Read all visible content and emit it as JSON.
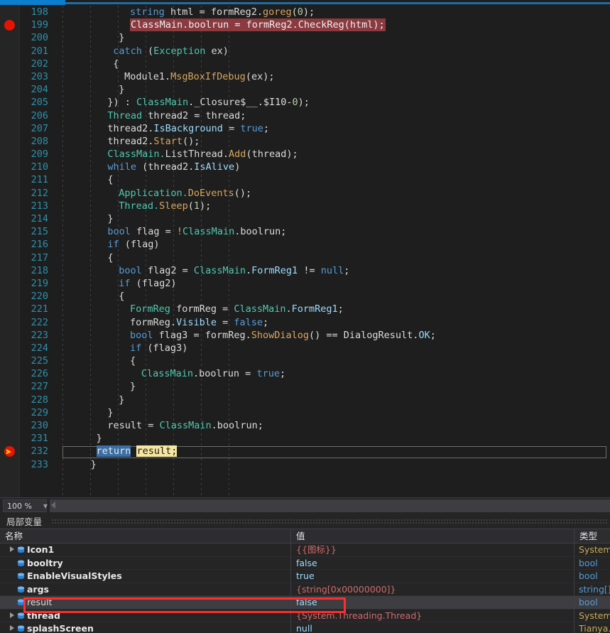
{
  "editor": {
    "zoom_level": "100 %",
    "lines": [
      {
        "num": "198",
        "indent": 12,
        "tokens": [
          {
            "t": "string",
            "c": "k"
          },
          {
            "t": " html = formReg2.",
            "c": "d"
          },
          {
            "t": "goreg",
            "c": "m"
          },
          {
            "t": "(",
            "c": "d"
          },
          {
            "t": "0",
            "c": "n"
          },
          {
            "t": ");",
            "c": "d"
          }
        ]
      },
      {
        "num": "199",
        "indent": 12,
        "breakpoint": true,
        "error_highlight": true,
        "tokens": [
          {
            "t": "ClassMain.boolrun = formReg2.CheckReg(html);",
            "c": "d"
          }
        ]
      },
      {
        "num": "200",
        "indent": 10,
        "tokens": [
          {
            "t": "}",
            "c": "d"
          }
        ]
      },
      {
        "num": "201",
        "indent": 9,
        "tokens": [
          {
            "t": "catch",
            "c": "k"
          },
          {
            "t": " (",
            "c": "d"
          },
          {
            "t": "Exception",
            "c": "t"
          },
          {
            "t": " ex)",
            "c": "d"
          }
        ]
      },
      {
        "num": "202",
        "indent": 9,
        "tokens": [
          {
            "t": "{",
            "c": "d"
          }
        ]
      },
      {
        "num": "203",
        "indent": 11,
        "tokens": [
          {
            "t": "Module1.",
            "c": "d"
          },
          {
            "t": "MsgBoxIfDebug",
            "c": "m"
          },
          {
            "t": "(ex);",
            "c": "d"
          }
        ]
      },
      {
        "num": "204",
        "indent": 10,
        "tokens": [
          {
            "t": "}",
            "c": "d"
          }
        ]
      },
      {
        "num": "205",
        "indent": 8,
        "tokens": [
          {
            "t": "}) : ",
            "c": "d"
          },
          {
            "t": "ClassMain",
            "c": "t"
          },
          {
            "t": "._Closure$__.$I10-",
            "c": "d"
          },
          {
            "t": "0",
            "c": "n"
          },
          {
            "t": ");",
            "c": "d"
          }
        ]
      },
      {
        "num": "206",
        "indent": 8,
        "tokens": [
          {
            "t": "Thread",
            "c": "t"
          },
          {
            "t": " thread2 = thread;",
            "c": "d"
          }
        ]
      },
      {
        "num": "207",
        "indent": 8,
        "tokens": [
          {
            "t": "thread2.",
            "c": "d"
          },
          {
            "t": "IsBackground",
            "c": "p"
          },
          {
            "t": " = ",
            "c": "d"
          },
          {
            "t": "true",
            "c": "k"
          },
          {
            "t": ";",
            "c": "d"
          }
        ]
      },
      {
        "num": "208",
        "indent": 8,
        "tokens": [
          {
            "t": "thread2.",
            "c": "d"
          },
          {
            "t": "Start",
            "c": "m"
          },
          {
            "t": "();",
            "c": "d"
          }
        ]
      },
      {
        "num": "209",
        "indent": 8,
        "tokens": [
          {
            "t": "ClassMain.",
            "c": "t"
          },
          {
            "t": "ListThread.",
            "c": "d"
          },
          {
            "t": "Add",
            "c": "m"
          },
          {
            "t": "(thread);",
            "c": "d"
          }
        ]
      },
      {
        "num": "210",
        "indent": 8,
        "tokens": [
          {
            "t": "while",
            "c": "k"
          },
          {
            "t": " (thread2.",
            "c": "d"
          },
          {
            "t": "IsAlive",
            "c": "p"
          },
          {
            "t": ")",
            "c": "d"
          }
        ]
      },
      {
        "num": "211",
        "indent": 8,
        "tokens": [
          {
            "t": "{",
            "c": "d"
          }
        ]
      },
      {
        "num": "212",
        "indent": 10,
        "tokens": [
          {
            "t": "Application.",
            "c": "t"
          },
          {
            "t": "DoEvents",
            "c": "m"
          },
          {
            "t": "();",
            "c": "d"
          }
        ]
      },
      {
        "num": "213",
        "indent": 10,
        "tokens": [
          {
            "t": "Thread.",
            "c": "t"
          },
          {
            "t": "Sleep",
            "c": "m"
          },
          {
            "t": "(",
            "c": "d"
          },
          {
            "t": "1",
            "c": "n"
          },
          {
            "t": ");",
            "c": "d"
          }
        ]
      },
      {
        "num": "214",
        "indent": 8,
        "tokens": [
          {
            "t": "}",
            "c": "d"
          }
        ]
      },
      {
        "num": "215",
        "indent": 8,
        "tokens": [
          {
            "t": "bool",
            "c": "k"
          },
          {
            "t": " flag = ",
            "c": "d"
          },
          {
            "t": "!",
            "c": "m"
          },
          {
            "t": "ClassMain",
            "c": "t"
          },
          {
            "t": ".boolrun;",
            "c": "d"
          }
        ]
      },
      {
        "num": "216",
        "indent": 8,
        "tokens": [
          {
            "t": "if",
            "c": "k"
          },
          {
            "t": " (flag)",
            "c": "d"
          }
        ]
      },
      {
        "num": "217",
        "indent": 8,
        "tokens": [
          {
            "t": "{",
            "c": "d"
          }
        ]
      },
      {
        "num": "218",
        "indent": 10,
        "tokens": [
          {
            "t": "bool",
            "c": "k"
          },
          {
            "t": " flag2 = ",
            "c": "d"
          },
          {
            "t": "ClassMain",
            "c": "t"
          },
          {
            "t": ".",
            "c": "d"
          },
          {
            "t": "FormReg1",
            "c": "p"
          },
          {
            "t": " != ",
            "c": "d"
          },
          {
            "t": "null",
            "c": "k"
          },
          {
            "t": ";",
            "c": "d"
          }
        ]
      },
      {
        "num": "219",
        "indent": 10,
        "tokens": [
          {
            "t": "if",
            "c": "k"
          },
          {
            "t": " (flag2)",
            "c": "d"
          }
        ]
      },
      {
        "num": "220",
        "indent": 10,
        "tokens": [
          {
            "t": "{",
            "c": "d"
          }
        ]
      },
      {
        "num": "221",
        "indent": 12,
        "tokens": [
          {
            "t": "FormReg",
            "c": "t"
          },
          {
            "t": " formReg = ",
            "c": "d"
          },
          {
            "t": "ClassMain",
            "c": "t"
          },
          {
            "t": ".",
            "c": "d"
          },
          {
            "t": "FormReg1",
            "c": "p"
          },
          {
            "t": ";",
            "c": "d"
          }
        ]
      },
      {
        "num": "222",
        "indent": 12,
        "tokens": [
          {
            "t": "formReg.",
            "c": "d"
          },
          {
            "t": "Visible",
            "c": "p"
          },
          {
            "t": " = ",
            "c": "d"
          },
          {
            "t": "false",
            "c": "k"
          },
          {
            "t": ";",
            "c": "d"
          }
        ]
      },
      {
        "num": "223",
        "indent": 12,
        "tokens": [
          {
            "t": "bool",
            "c": "k"
          },
          {
            "t": " flag3 = formReg.",
            "c": "d"
          },
          {
            "t": "ShowDialog",
            "c": "m"
          },
          {
            "t": "() == DialogResult.",
            "c": "d"
          },
          {
            "t": "OK",
            "c": "p"
          },
          {
            "t": ";",
            "c": "d"
          }
        ]
      },
      {
        "num": "224",
        "indent": 12,
        "tokens": [
          {
            "t": "if",
            "c": "k"
          },
          {
            "t": " (flag3)",
            "c": "d"
          }
        ]
      },
      {
        "num": "225",
        "indent": 12,
        "tokens": [
          {
            "t": "{",
            "c": "d"
          }
        ]
      },
      {
        "num": "226",
        "indent": 14,
        "tokens": [
          {
            "t": "ClassMain",
            "c": "t"
          },
          {
            "t": ".boolrun = ",
            "c": "d"
          },
          {
            "t": "true",
            "c": "k"
          },
          {
            "t": ";",
            "c": "d"
          }
        ]
      },
      {
        "num": "227",
        "indent": 12,
        "tokens": [
          {
            "t": "}",
            "c": "d"
          }
        ]
      },
      {
        "num": "228",
        "indent": 10,
        "tokens": [
          {
            "t": "}",
            "c": "d"
          }
        ]
      },
      {
        "num": "229",
        "indent": 8,
        "tokens": [
          {
            "t": "}",
            "c": "d"
          }
        ]
      },
      {
        "num": "230",
        "indent": 8,
        "tokens": [
          {
            "t": "result = ",
            "c": "d"
          },
          {
            "t": "ClassMain",
            "c": "t"
          },
          {
            "t": ".boolrun;",
            "c": "d"
          }
        ]
      },
      {
        "num": "231",
        "indent": 6,
        "tokens": [
          {
            "t": "}",
            "c": "d"
          }
        ]
      },
      {
        "num": "232",
        "indent": 6,
        "current": true,
        "breakpoint_current": true,
        "tokens": []
      },
      {
        "num": "233",
        "indent": 5,
        "tokens": [
          {
            "t": "}",
            "c": "d"
          }
        ]
      }
    ],
    "current_line": {
      "keyword": "return",
      "expression": "result;"
    }
  },
  "locals": {
    "title": "局部变量",
    "columns": [
      "名称",
      "值",
      "类型"
    ],
    "rows": [
      {
        "expandable": true,
        "name": "Icon1",
        "value": "{{图标}}",
        "value_class": "v-brace",
        "type": "System.D",
        "type_class": "t-class"
      },
      {
        "expandable": false,
        "name": "booltry",
        "value": "false",
        "value_class": "v-bool",
        "type": "bool",
        "type_class": "t-prim"
      },
      {
        "expandable": false,
        "name": "EnableVisualStyles",
        "value": "true",
        "value_class": "v-bool",
        "type": "bool",
        "type_class": "t-prim"
      },
      {
        "expandable": false,
        "name": "args",
        "value": "{string[0x00000000]}",
        "value_class": "v-brace",
        "type": "string[]",
        "type_class": "t-prim"
      },
      {
        "expandable": false,
        "name": "result",
        "value": "false",
        "value_class": "v-bool",
        "type": "bool",
        "type_class": "t-prim",
        "selected": true,
        "annotated": true
      },
      {
        "expandable": true,
        "name": "thread",
        "value": "{System.Threading.Thread}",
        "value_class": "v-brace",
        "type": "System.T",
        "type_class": "t-class"
      },
      {
        "expandable": true,
        "name": "splashScreen",
        "value": "null",
        "value_class": "v-null",
        "type": "Tianya.C",
        "type_class": "t-class"
      }
    ]
  },
  "colors": {
    "accent_blue": "#0c7ed0",
    "breakpoint_red": "#e51400",
    "annotation_red": "#ff2d2d",
    "error_highlight": "#8b3a3f",
    "selection_blue": "#3a6ea5",
    "highlight_yellow": "#f5e6a0"
  }
}
